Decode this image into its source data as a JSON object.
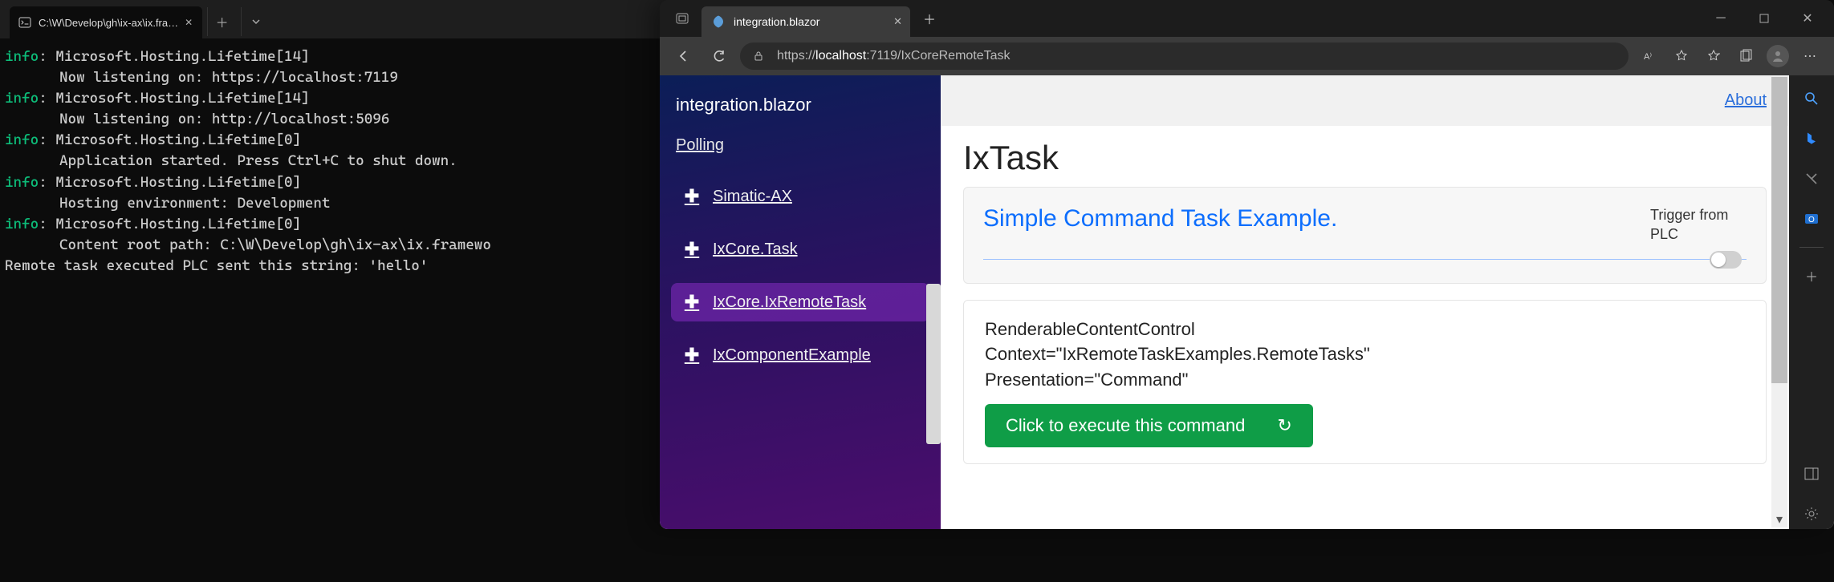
{
  "terminal": {
    "tab_title": "C:\\W\\Develop\\gh\\ix-ax\\ix.fra…",
    "lines": [
      {
        "p": "info",
        "t": ": Microsoft.Hosting.Lifetime[14]"
      },
      {
        "i": true,
        "t": "Now listening on: https://localhost:7119"
      },
      {
        "p": "info",
        "t": ": Microsoft.Hosting.Lifetime[14]"
      },
      {
        "i": true,
        "t": "Now listening on: http://localhost:5096"
      },
      {
        "p": "info",
        "t": ": Microsoft.Hosting.Lifetime[0]"
      },
      {
        "i": true,
        "t": "Application started. Press Ctrl+C to shut down."
      },
      {
        "p": "info",
        "t": ": Microsoft.Hosting.Lifetime[0]"
      },
      {
        "i": true,
        "t": "Hosting environment: Development"
      },
      {
        "p": "info",
        "t": ": Microsoft.Hosting.Lifetime[0]"
      },
      {
        "i": true,
        "t": "Content root path: C:\\W\\Develop\\gh\\ix-ax\\ix.framewo"
      },
      {
        "t": "Remote task executed PLC sent this string: 'hello'"
      }
    ]
  },
  "browser": {
    "tab_title": "integration.blazor",
    "url_pre": "https://",
    "url_host": "localhost",
    "url_post": ":7119/IxCoreRemoteTask"
  },
  "app": {
    "brand": "integration.blazor",
    "polling_label": "Polling",
    "about_label": "About",
    "nav": [
      {
        "label": "Simatic-AX",
        "active": false
      },
      {
        "label": "IxCore.Task",
        "active": false
      },
      {
        "label": "IxCore.IxRemoteTask",
        "active": true
      },
      {
        "label": "IxComponentExample",
        "active": false
      }
    ],
    "page_title": "IxTask",
    "card_title": "Simple Command Task Example.",
    "trigger_label": "Trigger from PLC",
    "render_lines": [
      "RenderableContentControl",
      "Context=\"IxRemoteTaskExamples.RemoteTasks\"",
      "Presentation=\"Command\""
    ],
    "exec_label": "Click to execute this command"
  }
}
